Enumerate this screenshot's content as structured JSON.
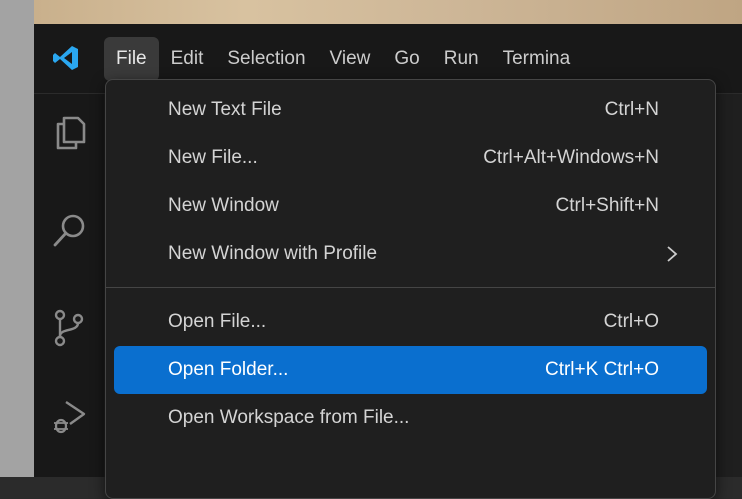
{
  "menubar": {
    "items": [
      "File",
      "Edit",
      "Selection",
      "View",
      "Go",
      "Run",
      "Termina"
    ],
    "active": "File"
  },
  "activity_bar": {
    "icons": [
      "explorer-icon",
      "search-icon",
      "source-control-icon",
      "run-debug-icon"
    ]
  },
  "file_menu": {
    "groups": [
      [
        {
          "label": "New Text File",
          "shortcut": "Ctrl+N"
        },
        {
          "label": "New File...",
          "shortcut": "Ctrl+Alt+Windows+N"
        },
        {
          "label": "New Window",
          "shortcut": "Ctrl+Shift+N"
        },
        {
          "label": "New Window with Profile",
          "shortcut": ""
        }
      ],
      [
        {
          "label": "Open File...",
          "shortcut": "Ctrl+O"
        },
        {
          "label": "Open Folder...",
          "shortcut": "Ctrl+K Ctrl+O"
        },
        {
          "label": "Open Workspace from File...",
          "shortcut": ""
        }
      ]
    ],
    "highlighted": "Open Folder..."
  },
  "colors": {
    "highlight": "#0a6fcf",
    "logo": "#2aa7f0",
    "menu_bg": "#1f1f1f"
  }
}
